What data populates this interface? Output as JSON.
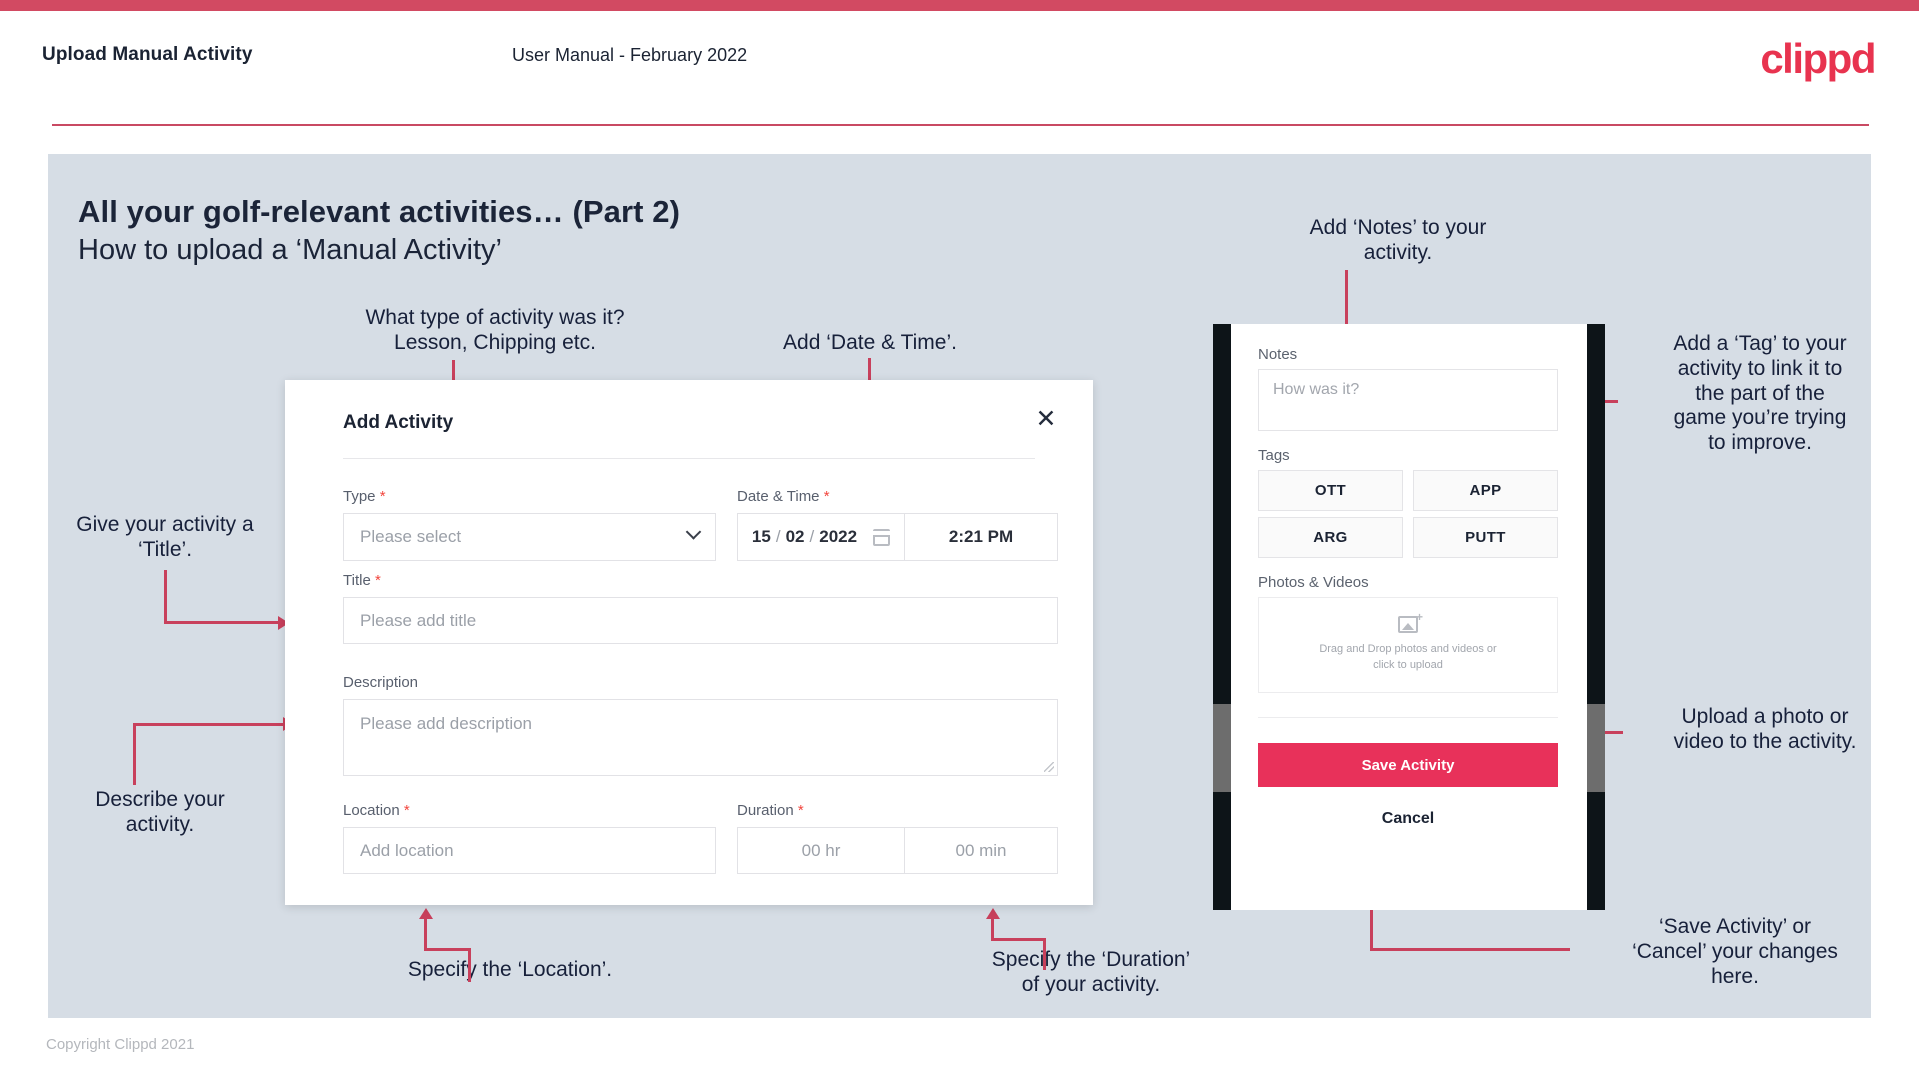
{
  "header": {
    "left_title": "Upload Manual Activity",
    "center_title": "User Manual - February 2022",
    "logo": "clippd",
    "accent_color": "#d24a62"
  },
  "slide": {
    "title": "All your golf-relevant activities… (Part 2)",
    "subtitle": "How to upload a ‘Manual Activity’",
    "background_color": "#d6dde5"
  },
  "annotations": {
    "type": "What type of activity was it?\nLesson, Chipping etc.",
    "date_time": "Add ‘Date & Time’.",
    "title": "Give your activity a\n‘Title’.",
    "description": "Describe your\nactivity.",
    "location": "Specify the ‘Location’.",
    "duration": "Specify the ‘Duration’\nof your activity.",
    "notes": "Add ‘Notes’ to your\nactivity.",
    "tags": "Add a ‘Tag’ to your\nactivity to link it to\nthe part of the\ngame you’re trying\nto improve.",
    "photos": "Upload a photo or\nvideo to the activity.",
    "save_cancel": "‘Save Activity’ or\n‘Cancel’ your changes\nhere."
  },
  "dialog": {
    "title": "Add Activity",
    "close_icon": "close-icon",
    "fields": {
      "type": {
        "label": "Type",
        "required": "*",
        "placeholder": "Please select"
      },
      "date_time": {
        "label": "Date & Time",
        "required": "*",
        "day": "15",
        "month": "02",
        "year": "2022",
        "sep": "/",
        "time": "2:21 PM"
      },
      "title": {
        "label": "Title",
        "required": "*",
        "placeholder": "Please add title"
      },
      "description": {
        "label": "Description",
        "required": "",
        "placeholder": "Please add description"
      },
      "location": {
        "label": "Location",
        "required": "*",
        "placeholder": "Add location"
      },
      "duration": {
        "label": "Duration",
        "required": "*",
        "hours": "00 hr",
        "minutes": "00 min"
      }
    }
  },
  "phone": {
    "notes": {
      "label": "Notes",
      "placeholder": "How was it?"
    },
    "tags": {
      "label": "Tags",
      "items": [
        "OTT",
        "APP",
        "ARG",
        "PUTT"
      ]
    },
    "photos": {
      "label": "Photos & Videos",
      "icon": "add-image-icon",
      "drop_line1": "Drag and Drop photos and videos or",
      "drop_line2": "click to upload"
    },
    "save_label": "Save Activity",
    "cancel_label": "Cancel",
    "save_color": "#e8315a"
  },
  "footer": {
    "copyright": "Copyright Clippd 2021"
  }
}
